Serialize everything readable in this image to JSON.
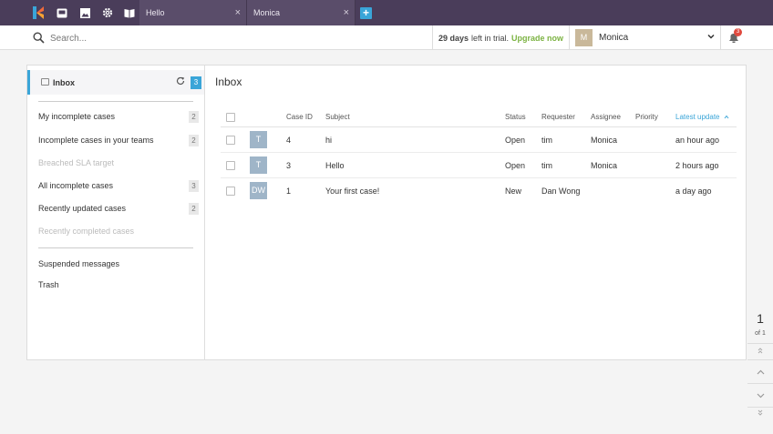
{
  "topbar": {
    "icons": [
      "logo-icon",
      "inbox-icon",
      "image-icon",
      "gear-icon",
      "book-icon"
    ],
    "tabs": [
      {
        "label": "Hello"
      },
      {
        "label": "Monica"
      }
    ],
    "add_tab": "+"
  },
  "search": {
    "placeholder": "Search..."
  },
  "trial": {
    "days": "29 days",
    "text": "left in trial.",
    "upgrade": "Upgrade now"
  },
  "user": {
    "avatar_initial": "M",
    "name": "Monica",
    "notifications": "3"
  },
  "sidebar": {
    "inbox_label": "Inbox",
    "inbox_count": "3",
    "items": [
      {
        "label": "My incomplete cases",
        "count": "2"
      },
      {
        "label": "Incomplete cases in your teams",
        "count": "2"
      },
      {
        "label": "Breached SLA target",
        "count": ""
      },
      {
        "label": "All incomplete cases",
        "count": "3"
      },
      {
        "label": "Recently updated cases",
        "count": "2"
      },
      {
        "label": "Recently completed cases",
        "count": ""
      },
      {
        "label": "Suspended messages",
        "count": ""
      },
      {
        "label": "Trash",
        "count": ""
      }
    ]
  },
  "content": {
    "title": "Inbox",
    "columns": [
      "Case ID",
      "Subject",
      "Status",
      "Requester",
      "Assignee",
      "Priority",
      "Latest update"
    ],
    "rows": [
      {
        "avatar": "T",
        "case_id": "4",
        "subject": "hi",
        "status": "Open",
        "requester": "tim",
        "assignee": "Monica",
        "priority": "",
        "latest_update": "an hour ago"
      },
      {
        "avatar": "T",
        "case_id": "3",
        "subject": "Hello",
        "status": "Open",
        "requester": "tim",
        "assignee": "Monica",
        "priority": "",
        "latest_update": "2 hours ago"
      },
      {
        "avatar": "DW",
        "case_id": "1",
        "subject": "Your first case!",
        "status": "New",
        "requester": "Dan Wong",
        "assignee": "",
        "priority": "",
        "latest_update": "a day ago"
      }
    ]
  },
  "pager": {
    "page": "1",
    "of": "of 1"
  },
  "colors": {
    "topbar": "#4a3d5a",
    "accent": "#3aa5d8",
    "upgrade": "#7cb342",
    "badge": "#e04a3f"
  }
}
